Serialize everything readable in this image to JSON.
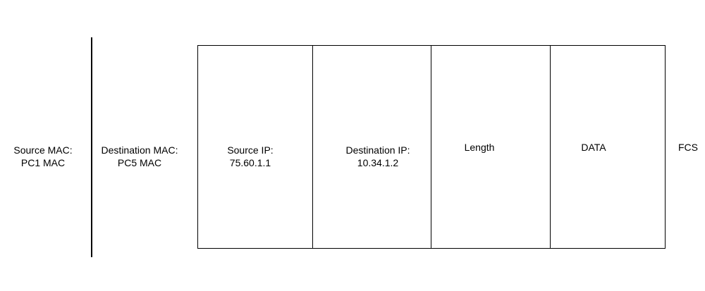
{
  "fields": {
    "source_mac": {
      "line1": "Source MAC:",
      "line2": "PC1 MAC"
    },
    "destination_mac": {
      "line1": "Destination MAC:",
      "line2": "PC5 MAC"
    },
    "source_ip": {
      "line1": "Source IP:",
      "line2": "75.60.1.1"
    },
    "destination_ip": {
      "line1": "Destination IP:",
      "line2": "10.34.1.2"
    },
    "length": {
      "label": "Length"
    },
    "data": {
      "label": "DATA"
    },
    "fcs": {
      "label": "FCS"
    }
  }
}
